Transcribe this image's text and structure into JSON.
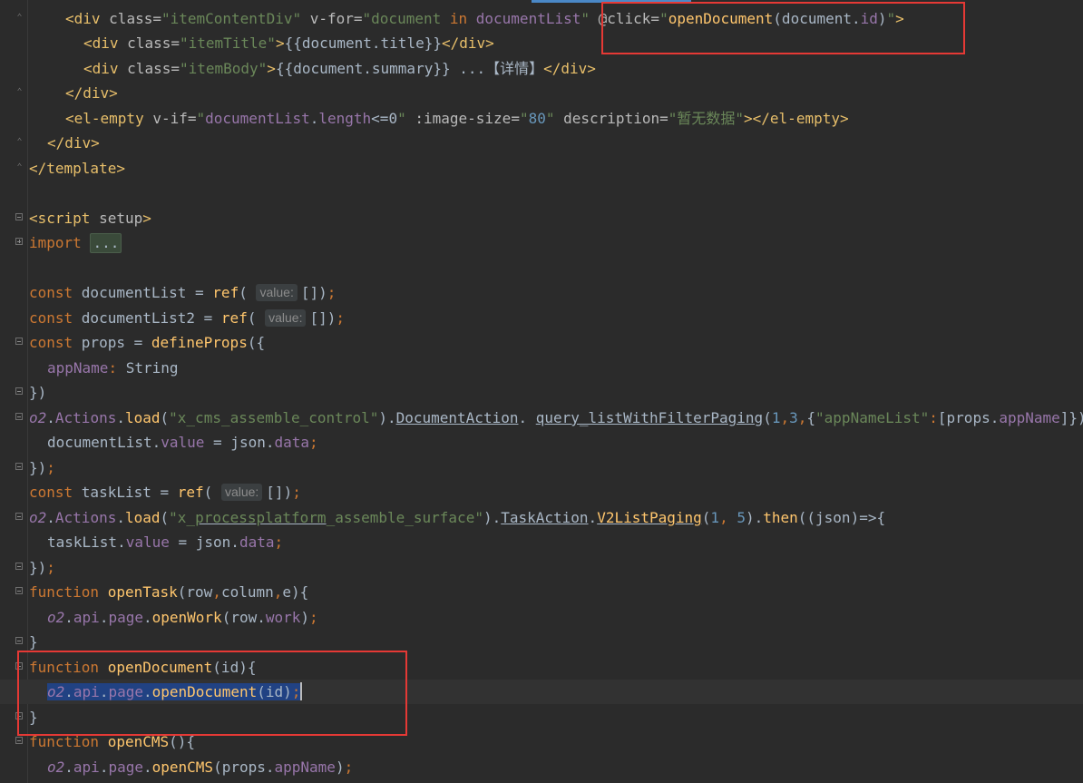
{
  "editor": {
    "lines": [
      {
        "parts": [
          [
            "tag",
            "<div "
          ],
          [
            "attr",
            "class="
          ],
          [
            "str",
            "\"itemContentDiv\""
          ],
          [
            "attr",
            " v-for="
          ],
          [
            "str",
            "\"document "
          ],
          [
            "kw",
            "in"
          ],
          [
            "str",
            " "
          ],
          [
            "prop",
            "documentList"
          ],
          [
            "str",
            "\""
          ],
          [
            "attr",
            " @click="
          ],
          [
            "str",
            "\""
          ],
          [
            "fn",
            "openDocument"
          ],
          [
            "plain",
            "(document."
          ],
          [
            "prop",
            "id"
          ],
          [
            "plain",
            ")"
          ],
          [
            "str",
            "\""
          ],
          [
            "tag",
            ">"
          ]
        ]
      },
      {
        "parts": [
          [
            "tag",
            "<div "
          ],
          [
            "attr",
            "class="
          ],
          [
            "str",
            "\"itemTitle\""
          ],
          [
            "tag",
            ">"
          ],
          [
            "plain",
            "{{document.title}}"
          ],
          [
            "tag",
            "</div>"
          ]
        ]
      },
      {
        "parts": [
          [
            "tag",
            "<div "
          ],
          [
            "attr",
            "class="
          ],
          [
            "str",
            "\"itemBody\""
          ],
          [
            "tag",
            ">"
          ],
          [
            "plain",
            "{{document.summary}} ...【详情】"
          ],
          [
            "tag",
            "</div>"
          ]
        ]
      },
      {
        "parts": [
          [
            "tag",
            "</div>"
          ]
        ]
      },
      {
        "parts": [
          [
            "tag",
            "<el-empty "
          ],
          [
            "attr",
            "v-if="
          ],
          [
            "str",
            "\""
          ],
          [
            "prop",
            "documentList"
          ],
          [
            "plain",
            "."
          ],
          [
            "prop",
            "length"
          ],
          [
            "plain",
            "<=0"
          ],
          [
            "str",
            "\""
          ],
          [
            "attr",
            " :image-size="
          ],
          [
            "str",
            "\""
          ],
          [
            "num",
            "80"
          ],
          [
            "str",
            "\""
          ],
          [
            "attr",
            " description="
          ],
          [
            "str",
            "\"暂无数据\""
          ],
          [
            "tag",
            "></el-empty>"
          ]
        ]
      },
      {
        "parts": [
          [
            "tag",
            "</div>"
          ]
        ]
      },
      {
        "parts": [
          [
            "tag",
            "</template>"
          ]
        ]
      },
      {
        "parts": []
      },
      {
        "parts": [
          [
            "tag",
            "<script "
          ],
          [
            "attr",
            "setup"
          ],
          [
            "tag",
            ">"
          ]
        ]
      },
      {
        "parts": [
          [
            "kw",
            "import "
          ],
          [
            "collapsed",
            "..."
          ]
        ]
      },
      {
        "parts": []
      },
      {
        "parts": [
          [
            "kw",
            "const "
          ],
          [
            "plain",
            "documentList = "
          ],
          [
            "fn",
            "ref"
          ],
          [
            "plain",
            "( "
          ],
          [
            "hint",
            "value:"
          ],
          [
            "plain",
            "[])"
          ],
          [
            "kw",
            ";"
          ]
        ]
      },
      {
        "parts": [
          [
            "kw",
            "const "
          ],
          [
            "plain",
            "documentList2 = "
          ],
          [
            "fn",
            "ref"
          ],
          [
            "plain",
            "( "
          ],
          [
            "hint",
            "value:"
          ],
          [
            "plain",
            "[])"
          ],
          [
            "kw",
            ";"
          ]
        ]
      },
      {
        "parts": [
          [
            "kw",
            "const "
          ],
          [
            "plain",
            "props = "
          ],
          [
            "fn",
            "defineProps"
          ],
          [
            "plain",
            "({"
          ]
        ]
      },
      {
        "parts": [
          [
            "prop",
            "appName"
          ],
          [
            "kw",
            ": "
          ],
          [
            "plain",
            "String"
          ]
        ]
      },
      {
        "parts": [
          [
            "plain",
            "})"
          ]
        ]
      },
      {
        "parts": [
          [
            "prop-ital",
            "o2"
          ],
          [
            "plain",
            "."
          ],
          [
            "prop",
            "Actions"
          ],
          [
            "plain",
            "."
          ],
          [
            "fn",
            "load"
          ],
          [
            "plain",
            "("
          ],
          [
            "str",
            "\"x_cms_assemble_control\""
          ],
          [
            "plain",
            ")."
          ],
          [
            "plain-ul",
            "DocumentAction"
          ],
          [
            "plain",
            ". "
          ],
          [
            "plain-ul",
            "query_listWithFilterPaging"
          ],
          [
            "plain",
            "("
          ],
          [
            "num",
            "1"
          ],
          [
            "kw",
            ","
          ],
          [
            "num",
            "3"
          ],
          [
            "kw",
            ","
          ],
          [
            "plain",
            "{"
          ],
          [
            "str",
            "\"appNameList\""
          ],
          [
            "kw",
            ":"
          ],
          [
            "plain",
            "[props."
          ],
          [
            "prop",
            "appName"
          ],
          [
            "plain",
            "]})"
          ]
        ]
      },
      {
        "parts": [
          [
            "plain",
            "documentList."
          ],
          [
            "prop",
            "value"
          ],
          [
            "plain",
            " = json."
          ],
          [
            "prop",
            "data"
          ],
          [
            "kw",
            ";"
          ]
        ]
      },
      {
        "parts": [
          [
            "plain",
            "})"
          ],
          [
            "kw",
            ";"
          ]
        ]
      },
      {
        "parts": [
          [
            "kw",
            "const "
          ],
          [
            "plain",
            "taskList = "
          ],
          [
            "fn",
            "ref"
          ],
          [
            "plain",
            "( "
          ],
          [
            "hint",
            "value:"
          ],
          [
            "plain",
            "[])"
          ],
          [
            "kw",
            ";"
          ]
        ]
      },
      {
        "parts": [
          [
            "prop-ital",
            "o2"
          ],
          [
            "plain",
            "."
          ],
          [
            "prop",
            "Actions"
          ],
          [
            "plain",
            "."
          ],
          [
            "fn",
            "load"
          ],
          [
            "plain",
            "("
          ],
          [
            "str",
            "\"x_"
          ],
          [
            "str-ul",
            "processplatform"
          ],
          [
            "str",
            "_assemble_surface\""
          ],
          [
            "plain",
            ")."
          ],
          [
            "plain-ul",
            "TaskAction"
          ],
          [
            "plain",
            "."
          ],
          [
            "fn-ul",
            "V2ListPaging"
          ],
          [
            "plain",
            "("
          ],
          [
            "num",
            "1"
          ],
          [
            "kw",
            ", "
          ],
          [
            "num",
            "5"
          ],
          [
            "plain",
            ")."
          ],
          [
            "fn",
            "then"
          ],
          [
            "plain",
            "((json)=>{"
          ]
        ]
      },
      {
        "parts": [
          [
            "plain",
            "taskList."
          ],
          [
            "prop",
            "value"
          ],
          [
            "plain",
            " = json."
          ],
          [
            "prop",
            "data"
          ],
          [
            "kw",
            ";"
          ]
        ]
      },
      {
        "parts": [
          [
            "plain",
            "})"
          ],
          [
            "kw",
            ";"
          ]
        ]
      },
      {
        "parts": [
          [
            "kw",
            "function "
          ],
          [
            "fn",
            "openTask"
          ],
          [
            "plain",
            "(row"
          ],
          [
            "kw",
            ","
          ],
          [
            "plain",
            "column"
          ],
          [
            "kw",
            ","
          ],
          [
            "plain",
            "e){"
          ]
        ]
      },
      {
        "parts": [
          [
            "prop-ital",
            "o2"
          ],
          [
            "plain",
            "."
          ],
          [
            "prop",
            "api"
          ],
          [
            "plain",
            "."
          ],
          [
            "prop",
            "page"
          ],
          [
            "plain",
            "."
          ],
          [
            "fn",
            "openWork"
          ],
          [
            "plain",
            "(row."
          ],
          [
            "prop",
            "work"
          ],
          [
            "plain",
            ")"
          ],
          [
            "kw",
            ";"
          ]
        ]
      },
      {
        "parts": [
          [
            "plain",
            "}"
          ]
        ]
      },
      {
        "parts": [
          [
            "kw",
            "function "
          ],
          [
            "fn",
            "openDocument"
          ],
          [
            "plain",
            "(id){"
          ]
        ]
      },
      {
        "parts": [
          [
            "sel-prop-ital",
            "o2"
          ],
          [
            "sel-plain",
            "."
          ],
          [
            "sel-prop",
            "api"
          ],
          [
            "sel-plain",
            "."
          ],
          [
            "sel-prop",
            "page"
          ],
          [
            "sel-plain",
            "."
          ],
          [
            "sel-fn",
            "openDocument"
          ],
          [
            "sel-plain",
            "(id)"
          ],
          [
            "sel-kw",
            ";"
          ],
          [
            "caret",
            ""
          ]
        ]
      },
      {
        "parts": [
          [
            "plain",
            "}"
          ]
        ]
      },
      {
        "parts": [
          [
            "kw",
            "function "
          ],
          [
            "fn",
            "openCMS"
          ],
          [
            "plain",
            "(){"
          ]
        ]
      },
      {
        "parts": [
          [
            "prop-ital",
            "o2"
          ],
          [
            "plain",
            "."
          ],
          [
            "prop",
            "api"
          ],
          [
            "plain",
            "."
          ],
          [
            "prop",
            "page"
          ],
          [
            "plain",
            "."
          ],
          [
            "fn",
            "openCMS"
          ],
          [
            "plain",
            "(props."
          ],
          [
            "prop",
            "appName"
          ],
          [
            "plain",
            ")"
          ],
          [
            "kw",
            ";"
          ]
        ]
      }
    ]
  }
}
